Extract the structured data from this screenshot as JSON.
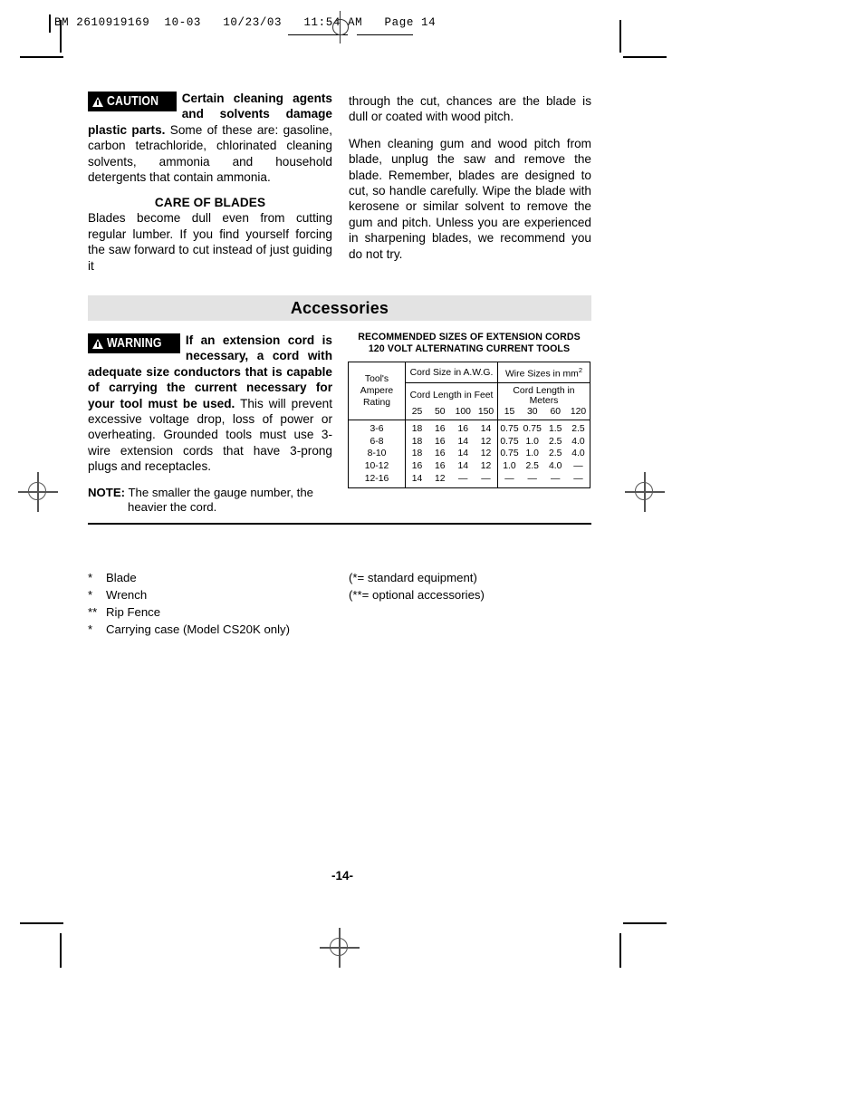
{
  "print_slug": {
    "text": "BM 2610919169  10-03   10/23/03   11:54 AM   Page 14"
  },
  "caution_block": {
    "badge_label": "CAUTION",
    "badge_icon": "warning-triangle-icon",
    "lead_text": "Certain cleaning agents and solvents damage plastic parts.",
    "body_text": " Some of these are: gasoline, carbon tetrachloride, chlorinated cleaning solvents, ammonia and household detergents that contain ammonia."
  },
  "care_of_blades": {
    "heading": "CARE OF BLADES",
    "paragraph": "Blades become dull even from cutting regular lumber. If you find yourself forcing the saw forward to cut instead of just guiding it"
  },
  "right_column": {
    "paragraph_1": "through the cut, chances are the blade is dull or coated with wood pitch.",
    "paragraph_2": "When cleaning gum and wood pitch from blade, unplug the saw and remove the blade. Remember, blades are designed to cut, so handle carefully. Wipe the blade with kerosene or similar solvent to remove the gum and pitch. Unless you are experienced in sharpening blades, we recommend you do not try."
  },
  "accessories_banner": {
    "title": "Accessories",
    "background_color": "#e3e3e3"
  },
  "warning_block": {
    "badge_label": "WARNING",
    "badge_icon": "warning-triangle-icon",
    "lead_text": "If an extension cord is necessary, a cord with adequate size conductors that is capable of carrying the current necessary for your tool must be used.",
    "body_text": " This will prevent excessive voltage drop, loss of power or overheating. Grounded tools must use 3-wire extension cords that have 3-prong plugs and receptacles."
  },
  "note": {
    "label": "NOTE:",
    "text": " The smaller the gauge number, the heavier the cord."
  },
  "cord_table": {
    "title_line_1": "RECOMMENDED SIZES OF EXTENSION CORDS",
    "title_line_2": "120 VOLT ALTERNATING CURRENT TOOLS",
    "amp_header_line_1": "Tool's",
    "amp_header_line_2": "Ampere",
    "amp_header_line_3": "Rating",
    "group_awg": "Cord Size in A.W.G.",
    "group_mm": "Wire Sizes in mm",
    "group_mm_sup": "2",
    "sub_feet": "Cord Length in Feet",
    "sub_meters": "Cord Length in Meters",
    "feet_lengths": [
      "25",
      "50",
      "100",
      "150"
    ],
    "meter_lengths": [
      "15",
      "30",
      "60",
      "120"
    ],
    "rows": [
      {
        "amps": "3-6",
        "awg": [
          "18",
          "16",
          "16",
          "14"
        ],
        "mm": [
          "0.75",
          "0.75",
          "1.5",
          "2.5"
        ]
      },
      {
        "amps": "6-8",
        "awg": [
          "18",
          "16",
          "14",
          "12"
        ],
        "mm": [
          "0.75",
          "1.0",
          "2.5",
          "4.0"
        ]
      },
      {
        "amps": "8-10",
        "awg": [
          "18",
          "16",
          "14",
          "12"
        ],
        "mm": [
          "0.75",
          "1.0",
          "2.5",
          "4.0"
        ]
      },
      {
        "amps": "10-12",
        "awg": [
          "16",
          "16",
          "14",
          "12"
        ],
        "mm": [
          "1.0",
          "2.5",
          "4.0",
          "—"
        ]
      },
      {
        "amps": "12-16",
        "awg": [
          "14",
          "12",
          "—",
          "—"
        ],
        "mm": [
          "—",
          "—",
          "—",
          "—"
        ]
      }
    ]
  },
  "accessories_list": {
    "items": [
      {
        "mark": "*",
        "label": "Blade"
      },
      {
        "mark": "*",
        "label": "Wrench"
      },
      {
        "mark": "**",
        "label": "Rip Fence"
      },
      {
        "mark": "*",
        "label": "Carrying case (Model CS20K only)"
      }
    ],
    "legend": [
      "(*= standard equipment)",
      "(**= optional accessories)"
    ]
  },
  "page_number": "-14-"
}
